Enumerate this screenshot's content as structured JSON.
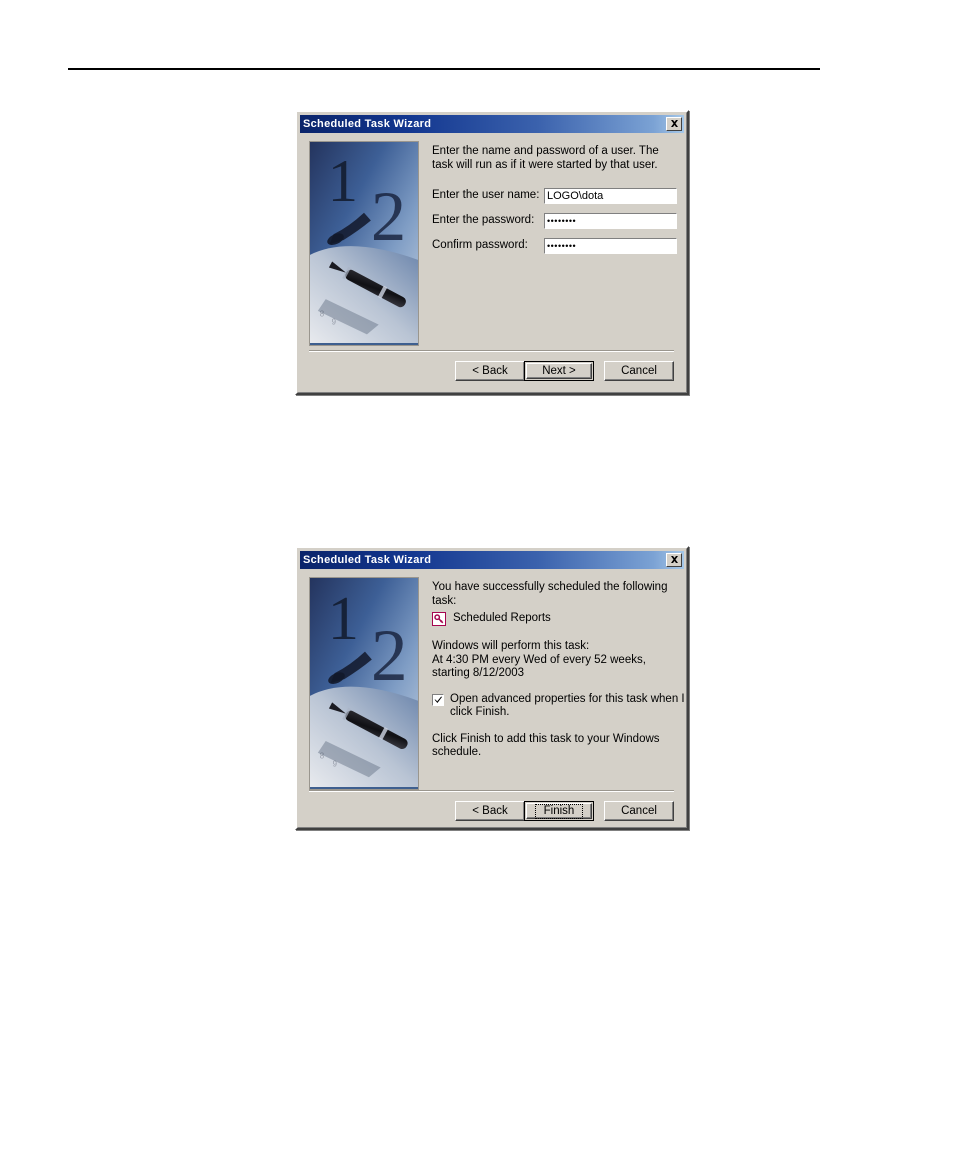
{
  "page": {
    "background_color": "#ffffff",
    "header_rule_color": "#000000"
  },
  "dialog_credentials": {
    "title": "Scheduled Task Wizard",
    "close_icon": "close-icon",
    "artwork": {
      "name": "wizard-clock-pen-artwork",
      "description": "Clock face with numbers 1 and 2 and a fountain pen resting on a calendar",
      "numerals": [
        "1",
        "2"
      ]
    },
    "intro_text": "Enter the name and password of a user.  The task will run as if it were started by that user.",
    "fields": [
      {
        "label": "Enter the user name:",
        "value": "LOGO\\dota",
        "masked": false,
        "name": "user-name-input"
      },
      {
        "label": "Enter the password:",
        "value": "••••••••",
        "masked": true,
        "name": "password-input"
      },
      {
        "label": "Confirm password:",
        "value": "••••••••",
        "masked": true,
        "name": "confirm-password-input"
      }
    ],
    "buttons": {
      "back": "< Back",
      "next": "Next >",
      "cancel": "Cancel",
      "default": "Next >"
    }
  },
  "dialog_confirmation": {
    "title": "Scheduled Task Wizard",
    "close_icon": "close-icon",
    "artwork": {
      "name": "wizard-clock-pen-artwork",
      "description": "Clock face with numbers 1 and 2 and a fountain pen resting on a calendar",
      "numerals": [
        "1",
        "2"
      ]
    },
    "success_line": "You have successfully scheduled the following task:",
    "task_name": "Scheduled Reports",
    "task_icon": "scheduled-task-key-icon",
    "task_icon_color": "#a5054f",
    "schedule_heading": "Windows will perform this task:",
    "schedule_detail": "At 4:30 PM every Wed of every 52 weeks, starting 8/12/2003",
    "advanced_checkbox": {
      "label": "Open advanced properties for this task when I click Finish.",
      "checked": true
    },
    "finish_hint": "Click Finish to add this task to your Windows schedule.",
    "buttons": {
      "back": "< Back",
      "finish": "Finish",
      "cancel": "Cancel",
      "default": "Finish"
    }
  }
}
